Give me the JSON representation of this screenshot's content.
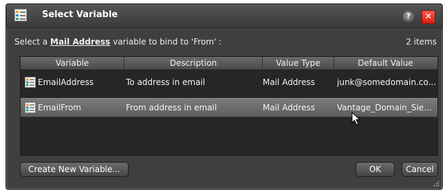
{
  "dialog": {
    "title": "Select Variable",
    "title_icon": "variable-list-icon",
    "help_label": "?",
    "close_label": "✕"
  },
  "prompt": {
    "prefix": "Select a ",
    "type": "Mail Address",
    "suffix": " variable to bind to 'From' :",
    "count": "2 items"
  },
  "table": {
    "columns": [
      "Variable",
      "Description",
      "Value Type",
      "Default Value"
    ],
    "rows": [
      {
        "name": "EmailAddress",
        "description": "To address in email",
        "value_type": "Mail Address",
        "default_value": "junk@somedomain.co..."
      },
      {
        "name": "EmailFrom",
        "description": "From address in email",
        "value_type": "Mail Address",
        "default_value": "Vantage_Domain_Sie..."
      }
    ],
    "selected_row": 1
  },
  "buttons": {
    "create": "Create New Variable...",
    "ok": "OK",
    "cancel": "Cancel"
  },
  "colors": {
    "dialog_bg": "#3f3f3f",
    "table_bg": "#262626",
    "close_red": "#e0261a"
  }
}
